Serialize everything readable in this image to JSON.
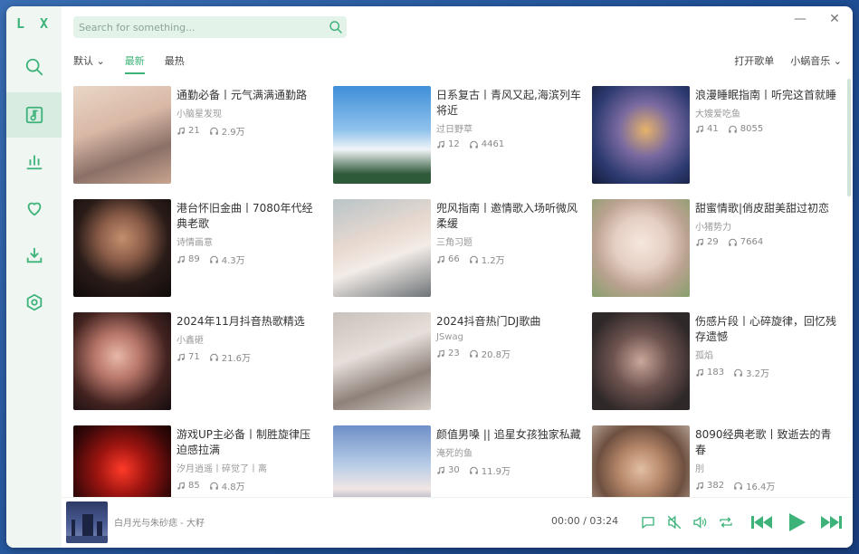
{
  "app": {
    "logo": "L X"
  },
  "search": {
    "placeholder": "Search for something..."
  },
  "window_controls": {
    "minimize": "—",
    "close": "✕"
  },
  "filters": {
    "sort": "默认 ⌄",
    "tabs": [
      "最新",
      "最热"
    ]
  },
  "actions": {
    "open_playlist": "打开歌单",
    "source": "小蜗音乐 ⌄"
  },
  "playlists": [
    {
      "title": "通勤必备丨元气满满通勤路",
      "author": "小脑星发现",
      "songs": "21",
      "plays": "2.9万"
    },
    {
      "title": "日系复古丨青风又起,海滨列车将近",
      "author": "过日野草",
      "songs": "12",
      "plays": "4461"
    },
    {
      "title": "浪漫睡眠指南丨听完这首就睡",
      "author": "大嫂爱吃鱼",
      "songs": "41",
      "plays": "8055"
    },
    {
      "title": "港台怀旧金曲丨7080年代经典老歌",
      "author": "诗情画意",
      "songs": "89",
      "plays": "4.3万"
    },
    {
      "title": "兜风指南丨邀情歌入场听微风柔缓",
      "author": "三角习题",
      "songs": "66",
      "plays": "1.2万"
    },
    {
      "title": "甜蜜情歌|俏皮甜美甜过初恋",
      "author": "小猪势力",
      "songs": "29",
      "plays": "7664"
    },
    {
      "title": "2024年11月抖音热歌精选",
      "author": "小鑫砸",
      "songs": "71",
      "plays": "21.6万"
    },
    {
      "title": "2024抖音热门DJ歌曲",
      "author": "JSwag",
      "songs": "23",
      "plays": "20.8万"
    },
    {
      "title": "伤感片段丨心碎旋律，回忆残存遗憾",
      "author": "孤焰",
      "songs": "183",
      "plays": "3.2万"
    },
    {
      "title": "游戏UP主必备丨制胜旋律压迫感拉满",
      "author": "汐月逍遥丨碎觉了丨离",
      "songs": "85",
      "plays": "4.8万"
    },
    {
      "title": "颜值男嗓 || 追星女孩独家私藏",
      "author": "淹死的鱼",
      "songs": "30",
      "plays": "11.9万"
    },
    {
      "title": "8090经典老歌丨致逝去的青春",
      "author": "刖",
      "songs": "382",
      "plays": "16.4万"
    }
  ],
  "player": {
    "song": "白月光与朱砂痣 - 大籽",
    "current": "00:00",
    "separator": "/",
    "total": "03:24"
  },
  "colors": {
    "accent": "#3db37a",
    "sidebar_bg": "#f0f7f3",
    "active_bg": "#d8ece1"
  }
}
